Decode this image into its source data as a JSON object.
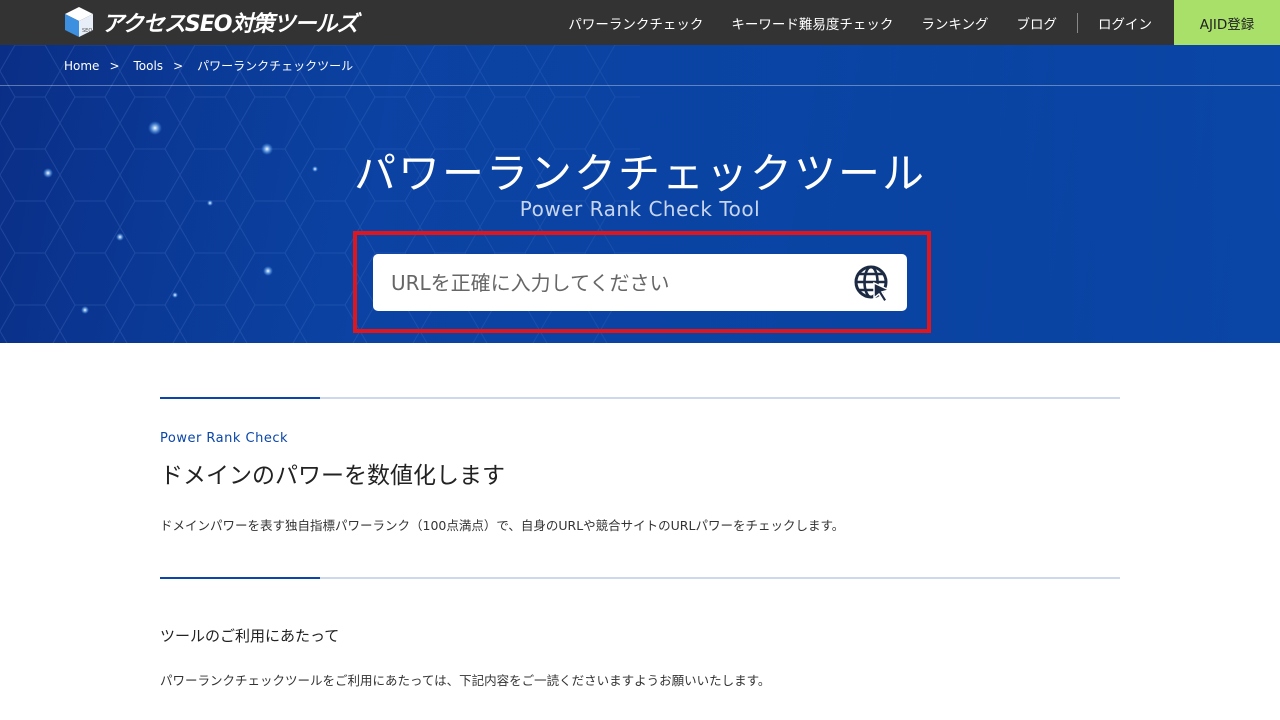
{
  "header": {
    "logo_text": "アクセスSEO対策ツールズ",
    "logo_badge": "SEO",
    "nav": [
      {
        "label": "パワーランクチェック"
      },
      {
        "label": "キーワード難易度チェック"
      },
      {
        "label": "ランキング"
      },
      {
        "label": "ブログ"
      }
    ],
    "login_label": "ログイン",
    "cta_label": "AJID登録",
    "cta_color": "#a8e06a",
    "bar_color": "#333333"
  },
  "breadcrumb": {
    "items": [
      "Home",
      "Tools"
    ],
    "separator": ">",
    "current": "パワーランクチェックツール"
  },
  "hero": {
    "title": "パワーランクチェックツール",
    "subtitle": "Power Rank Check Tool",
    "background_color": "#0b46a8",
    "highlight_color": "#e0161e"
  },
  "search": {
    "placeholder": "URLを正確に入力してください",
    "value": "",
    "button_icon": "globe-cursor-icon"
  },
  "intro": {
    "eyebrow": "Power Rank Check",
    "heading": "ドメインのパワーを数値化します",
    "body": "ドメインパワーを表す独自指標パワーランク（100点満点）で、自身のURLや競合サイトのURLパワーをチェックします。"
  },
  "usage": {
    "heading": "ツールのご利用にあたって",
    "body": "パワーランクチェックツールをご利用にあたっては、下記内容をご一読くださいますようお願いいたします。"
  }
}
